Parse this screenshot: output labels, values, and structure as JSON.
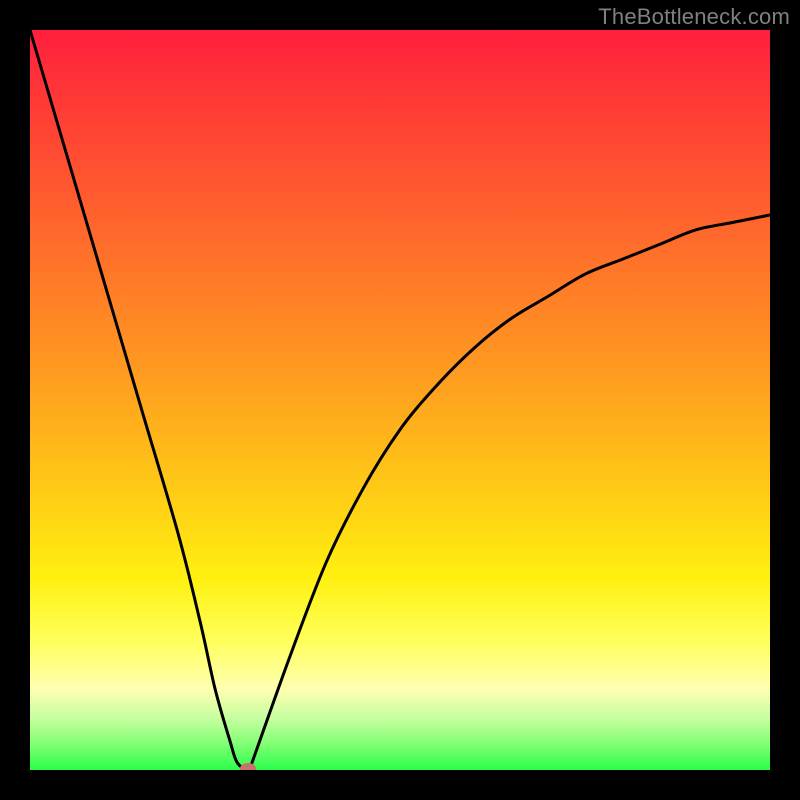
{
  "watermark": "TheBottleneck.com",
  "chart_data": {
    "type": "line",
    "title": "",
    "xlabel": "",
    "ylabel": "",
    "ylim": [
      0,
      100
    ],
    "x": [
      0,
      5,
      10,
      15,
      20,
      23,
      25,
      27,
      28,
      29.5,
      30,
      35,
      40,
      45,
      50,
      55,
      60,
      65,
      70,
      75,
      80,
      85,
      90,
      95,
      100
    ],
    "values": [
      100,
      83,
      66,
      49,
      32,
      20,
      11,
      4,
      1,
      0,
      1,
      15,
      28,
      38,
      46,
      52,
      57,
      61,
      64,
      67,
      69,
      71,
      73,
      74,
      75
    ],
    "marker": {
      "x": 29.5,
      "y": 0
    },
    "notes": "V-shaped bottleneck curve; minimum (optimal) near x≈29.5% where mismatch ≈ 0. Background gradient encodes mismatch severity (red=high, green=low). Axes are unlabeled in the image."
  },
  "colors": {
    "curve": "#000000",
    "marker": "#c7726a",
    "background_top": "#ff1f3d",
    "background_bottom": "#2bff4a",
    "frame": "#000000"
  }
}
